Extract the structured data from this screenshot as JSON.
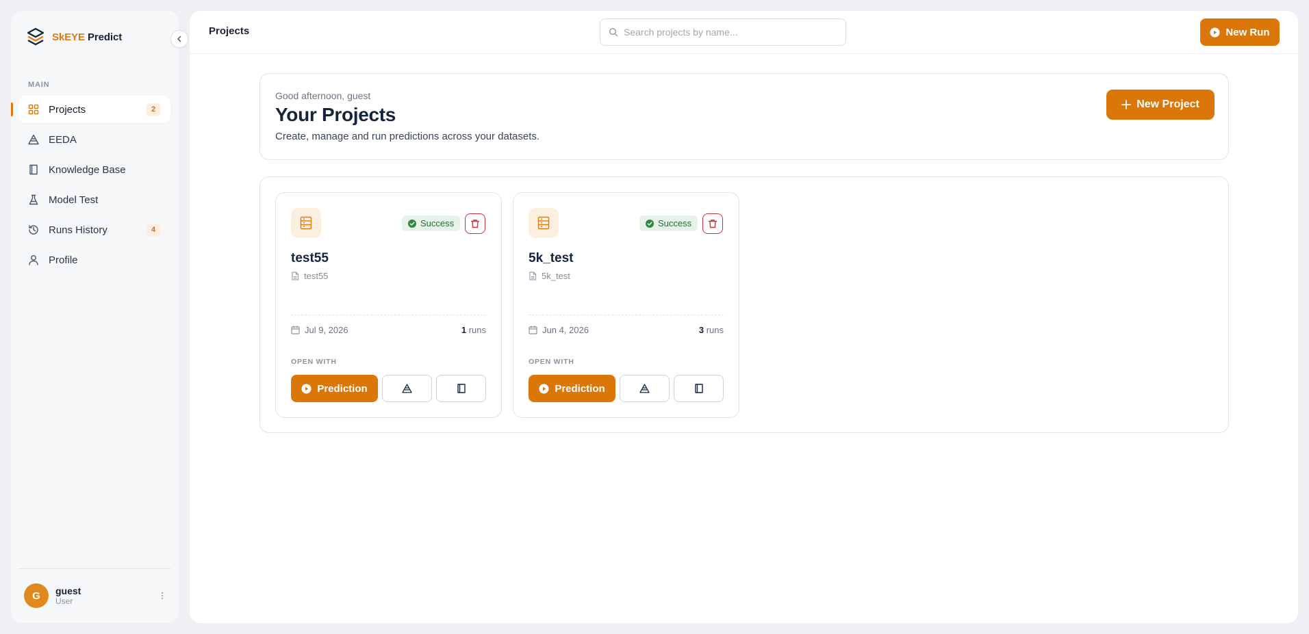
{
  "app": {
    "brand_prefix": "SkEYE",
    "brand_suffix": "Predict",
    "accent_color": "#db7708"
  },
  "sidebar": {
    "section_label": "MAIN",
    "items": [
      {
        "label": "Projects",
        "icon": "grid-icon",
        "badge": "2",
        "active": true
      },
      {
        "label": "EEDA",
        "icon": "triangle-layers-icon"
      },
      {
        "label": "Knowledge Base",
        "icon": "book-icon"
      },
      {
        "label": "Model Test",
        "icon": "flask-icon"
      },
      {
        "label": "Runs History",
        "icon": "history-icon",
        "badge": "4"
      },
      {
        "label": "Profile",
        "icon": "user-icon"
      }
    ],
    "user": {
      "initial": "G",
      "name": "guest",
      "role": "User"
    }
  },
  "header": {
    "title": "Projects",
    "search_placeholder": "Search projects by name...",
    "new_run_label": "New Run"
  },
  "hero": {
    "greeting": "Good afternoon, guest",
    "title": "Your Projects",
    "subtitle": "Create, manage and run predictions across your datasets.",
    "new_project_label": "New Project"
  },
  "projects": [
    {
      "name": "test55",
      "file": "test55",
      "status": "Success",
      "date": "Jul 9, 2026",
      "runs_count": "1",
      "runs_label": "runs",
      "open_with_label": "OPEN WITH",
      "prediction_label": "Prediction"
    },
    {
      "name": "5k_test",
      "file": "5k_test",
      "status": "Success",
      "date": "Jun 4, 2026",
      "runs_count": "3",
      "runs_label": "runs",
      "open_with_label": "OPEN WITH",
      "prediction_label": "Prediction"
    }
  ]
}
